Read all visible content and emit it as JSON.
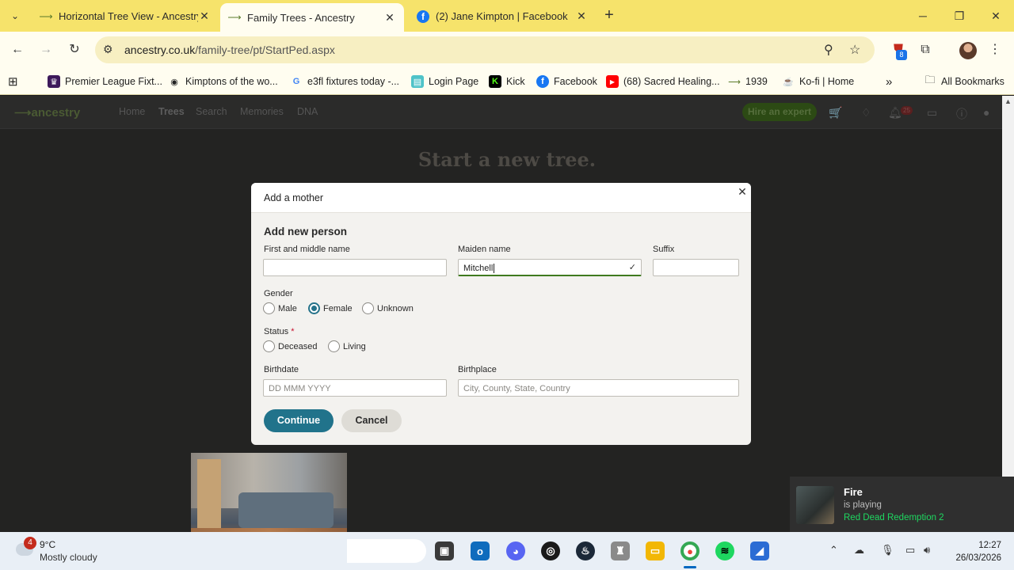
{
  "browser": {
    "tabs": [
      {
        "title": "Horizontal Tree View - Ancestry",
        "icon": "ancestry-leaf-icon",
        "active": false
      },
      {
        "title": "Family Trees - Ancestry",
        "icon": "ancestry-leaf-icon",
        "active": true
      },
      {
        "title": "(2) Jane Kimpton | Facebook",
        "icon": "facebook-icon",
        "active": false
      }
    ],
    "tab_close": "✕",
    "new_tab": "+",
    "url_domain": "ancestry.co.uk",
    "url_path": "/family-tree/pt/StartPed.aspx",
    "extension_badge": "8",
    "bookmarks": [
      {
        "label": "Premier League Fixt...",
        "icon": "premier-league-icon"
      },
      {
        "label": "Kimptons of the wo...",
        "icon": "globe-icon"
      },
      {
        "label": "e3fl fixtures today -...",
        "icon": "google-icon"
      },
      {
        "label": "Login Page",
        "icon": "login-page-icon"
      },
      {
        "label": "Kick",
        "icon": "kick-icon"
      },
      {
        "label": "Facebook",
        "icon": "facebook-icon"
      },
      {
        "label": "(68) Sacred Healing...",
        "icon": "youtube-icon"
      },
      {
        "label": "1939",
        "icon": "ancestry-leaf-icon"
      },
      {
        "label": "Ko-fi | Home",
        "icon": "kofi-icon"
      }
    ],
    "all_bookmarks": "All Bookmarks"
  },
  "site": {
    "logo": "ancestry",
    "nav": [
      "Home",
      "Trees",
      "Search",
      "Memories",
      "DNA"
    ],
    "active_nav": "Trees",
    "hire_button": "Hire an expert",
    "notification_count": "25",
    "background_title": "Start a new tree."
  },
  "modal": {
    "title": "Add a mother",
    "section": "Add new person",
    "first_name_label": "First and middle name",
    "first_name_value": "",
    "maiden_name_label": "Maiden name",
    "maiden_name_value": "Mitchell",
    "suffix_label": "Suffix",
    "suffix_value": "",
    "gender_label": "Gender",
    "gender_options": [
      "Male",
      "Female",
      "Unknown"
    ],
    "gender_selected": "Female",
    "status_label": "Status",
    "status_required": "*",
    "status_options": [
      "Deceased",
      "Living"
    ],
    "birthdate_label": "Birthdate",
    "birthdate_placeholder": "DD MMM YYYY",
    "birthplace_label": "Birthplace",
    "birthplace_placeholder": "City, County, State, Country",
    "continue": "Continue",
    "cancel": "Cancel"
  },
  "notification": {
    "title": "Fire",
    "subtitle": "is playing",
    "game": "Red Dead Redemption 2"
  },
  "taskbar": {
    "weather_badge": "4",
    "temp": "9°C",
    "weather": "Mostly cloudy",
    "time": "12:27",
    "date": "26/03/2026"
  },
  "colors": {
    "tab_bar": "#f6e36b",
    "primary_button": "#21738b",
    "hire_button": "#2c4a14",
    "focus_green": "#3f7a1f"
  }
}
